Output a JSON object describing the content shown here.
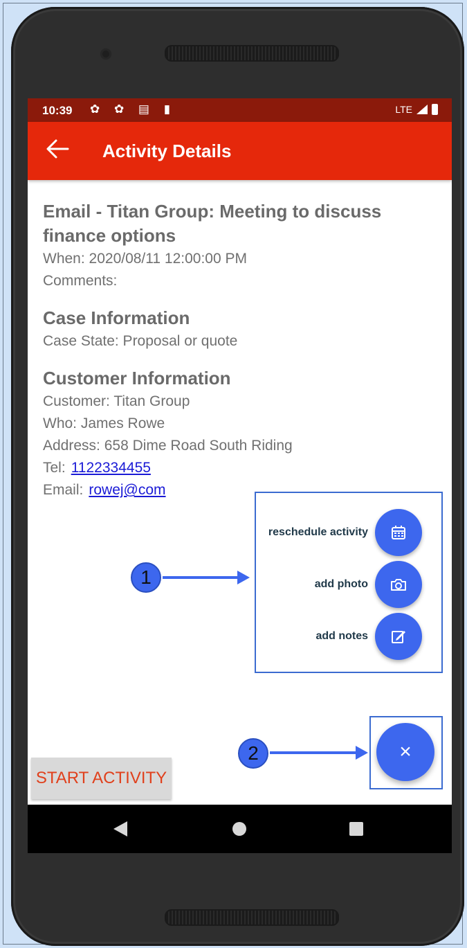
{
  "status_bar": {
    "time": "10:39",
    "icons": "✿ ✿ ▤ ▮",
    "network": "LTE"
  },
  "app_bar": {
    "title": "Activity Details"
  },
  "activity": {
    "title": "Email - Titan Group: Meeting to discuss finance options",
    "when": "When: 2020/08/11 12:00:00 PM",
    "comments": "Comments:"
  },
  "case": {
    "heading": "Case Information",
    "state": "Case State: Proposal or quote"
  },
  "customer": {
    "heading": "Customer Information",
    "customer": "Customer: Titan Group",
    "who": "Who: James Rowe",
    "address": "Address: 658 Dime Road South Riding",
    "tel_label": "Tel:",
    "tel_value": "1122334455",
    "email_label": "Email:",
    "email_value": "rowej@com"
  },
  "fab_menu": {
    "reschedule_label": "reschedule activity",
    "photo_label": "add photo",
    "notes_label": "add notes",
    "close_symbol": "×"
  },
  "start_button": {
    "label": "START ACTIVITY"
  },
  "callouts": {
    "one": "1",
    "two": "2"
  },
  "colors": {
    "accent": "#e5280b",
    "status_bar": "#8b1a0b",
    "fab": "#3d67ee"
  }
}
